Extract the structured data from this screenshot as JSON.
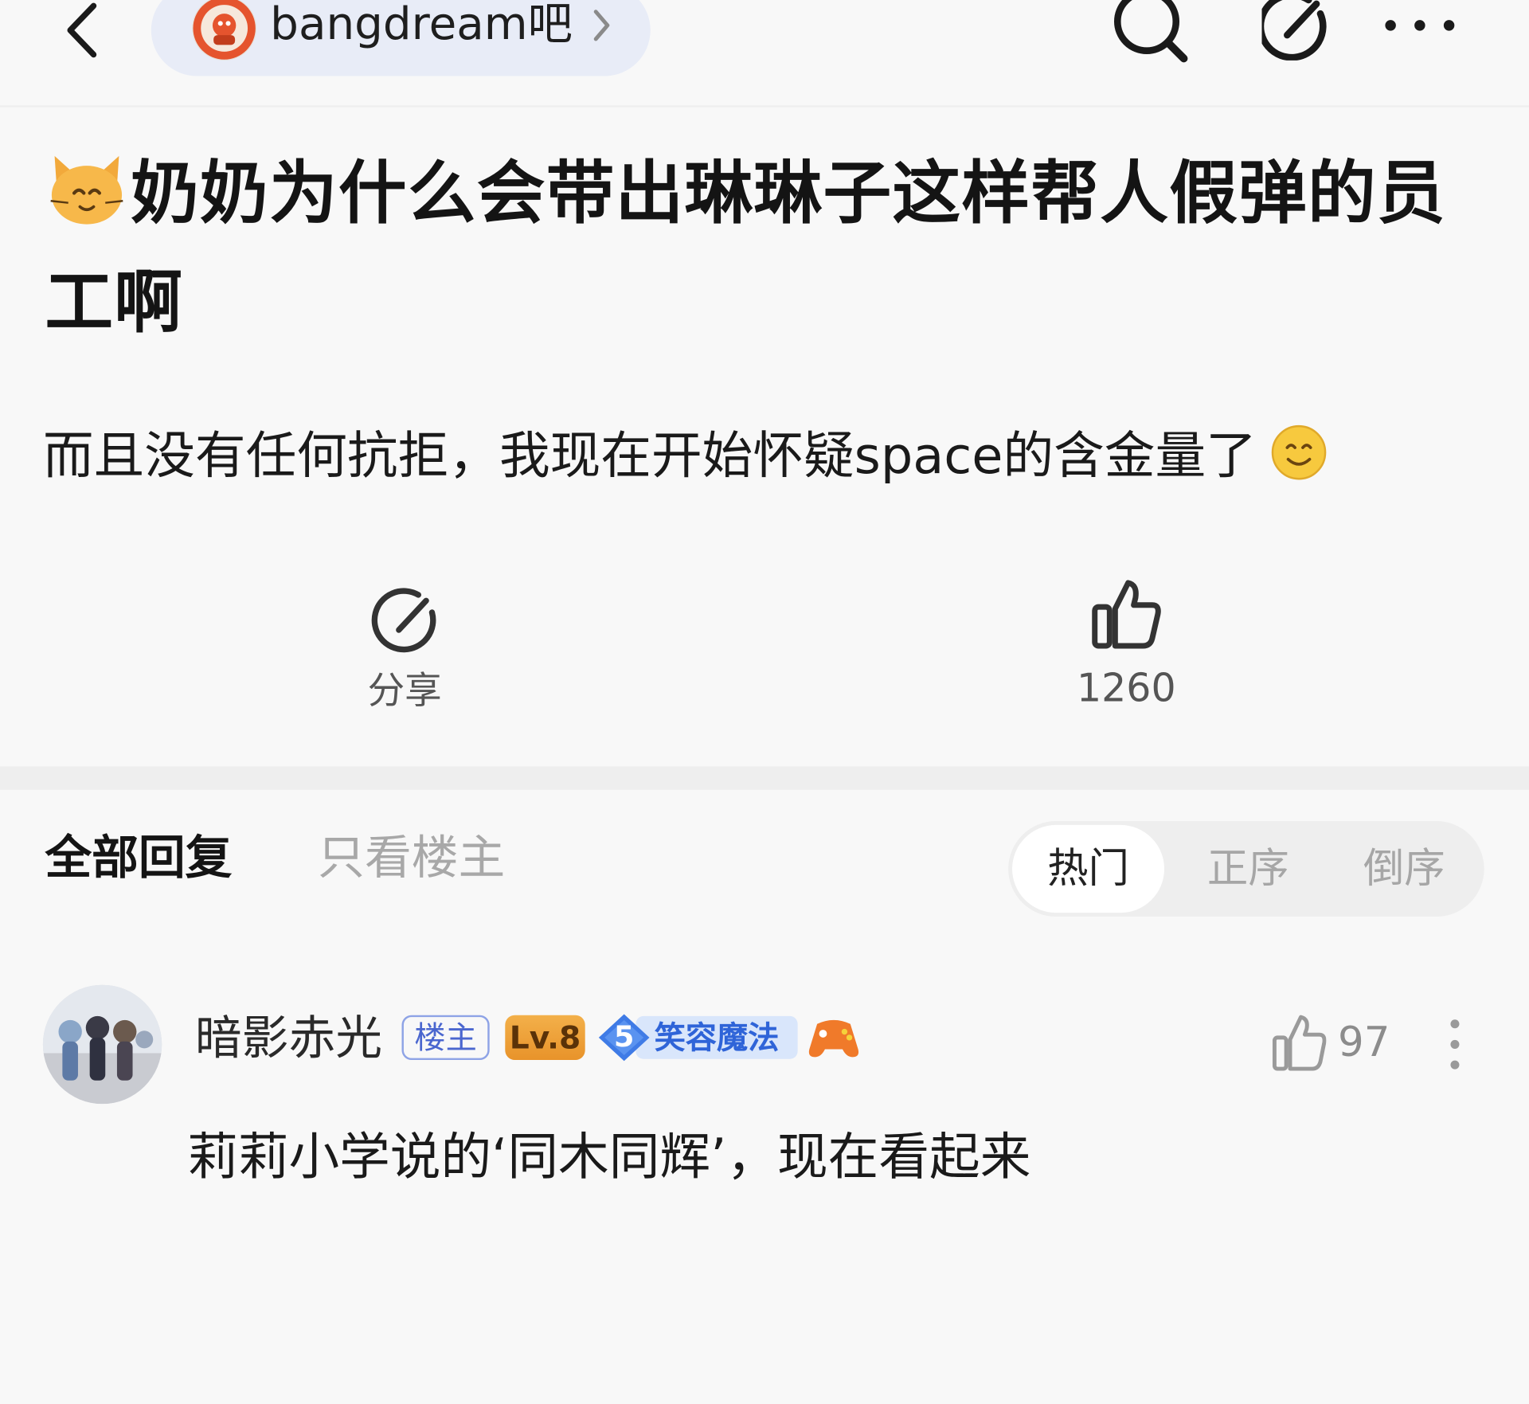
{
  "header": {
    "forum_name": "bangdream吧",
    "icons": [
      "back-arrow-icon",
      "forum-avatar-icon",
      "chevron-right-icon",
      "search-icon",
      "share-edit-icon",
      "more-dots-icon"
    ]
  },
  "post": {
    "title": "奶奶为什么会带出琳琳子这样帮人假弹的员工啊",
    "title_emoji": "cat-face-emoji",
    "body": "而且没有任何抗拒，我现在开始怀疑space的含金量了",
    "body_emoji": "smile-emoji"
  },
  "actions": {
    "share_label": "分享",
    "like_count": "1260"
  },
  "reply_tabs": {
    "all": "全部回复",
    "op_only": "只看楼主",
    "sort": [
      "热门",
      "正序",
      "倒序"
    ],
    "sort_selected": "热门"
  },
  "reply": {
    "username": "暗影赤光",
    "op_badge": "楼主",
    "level": "Lv.8",
    "fan_level": "5",
    "fan_title": "笑容魔法",
    "like_count": "97",
    "text_peek": "莉莉小学说的‘同木同辉’，现在看起来"
  },
  "colors": {
    "accent_blue": "#4a66cf",
    "level_orange": "#f0a63c",
    "background": "#f8f8f8"
  }
}
